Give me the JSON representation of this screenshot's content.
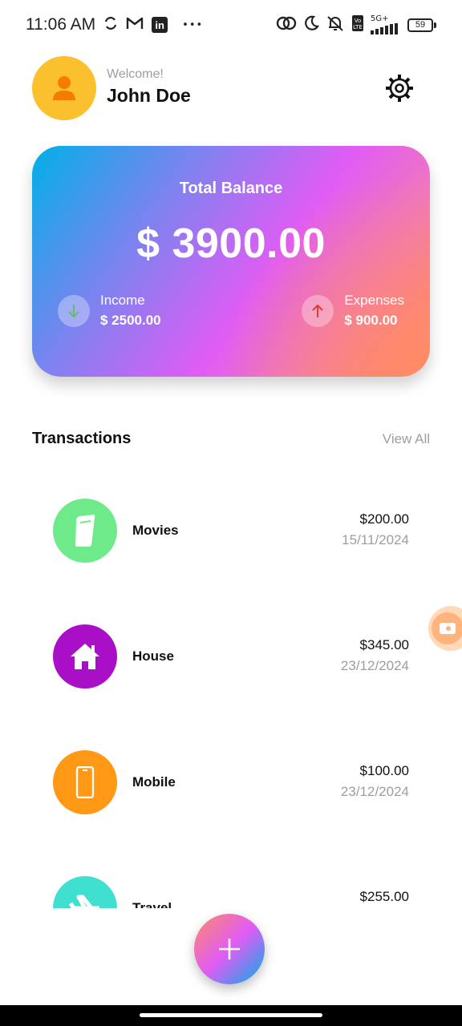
{
  "status_bar": {
    "time": "11:06 AM",
    "left_icons": [
      "sync-icon",
      "gmail-icon",
      "linkedin-icon",
      "more-dots-icon"
    ],
    "linkedin_glyph": "in",
    "more_glyph": "•••",
    "right_icons": [
      "link-icon",
      "moon-icon",
      "mute-icon",
      "volte-icon",
      "signal-5g-icon",
      "battery-icon"
    ],
    "network": "5G+",
    "battery": "59"
  },
  "header": {
    "welcome": "Welcome!",
    "name": "John Doe",
    "avatar_color": "#FBC02D",
    "avatar_icon": "person-icon",
    "settings_icon": "gear-icon"
  },
  "balance": {
    "title": "Total Balance",
    "amount": "$ 3900.00",
    "income_label": "Income",
    "income_value": "$ 2500.00",
    "expenses_label": "Expenses",
    "expenses_value": "$ 900.00",
    "income_icon": "arrow-down-icon",
    "expenses_icon": "arrow-up-icon",
    "income_color": "#66BB6A",
    "expenses_color": "#E53935"
  },
  "transactions": {
    "title": "Transactions",
    "view_all": "View All",
    "items": [
      {
        "name": "Movies",
        "amount": "$200.00",
        "date": "15/11/2024",
        "icon": "movie-ticket-icon",
        "color": "#6FEA8B"
      },
      {
        "name": "House",
        "amount": "$345.00",
        "date": "23/12/2024",
        "icon": "house-icon",
        "color": "#AA0FC8"
      },
      {
        "name": "Mobile",
        "amount": "$100.00",
        "date": "23/12/2024",
        "icon": "mobile-phone-icon",
        "color": "#FF9814"
      },
      {
        "name": "Travel",
        "amount": "$255.00",
        "date": "",
        "icon": "airplane-icon",
        "color": "#40E0D0"
      }
    ]
  },
  "fab": {
    "icon": "plus-icon"
  },
  "side_chip": {
    "icon": "video-camera-icon"
  }
}
